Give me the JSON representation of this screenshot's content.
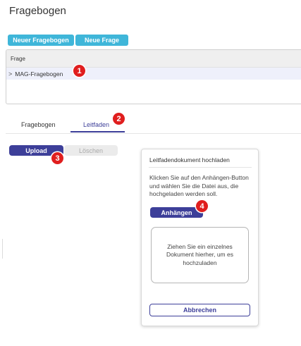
{
  "page": {
    "title": "Fragebogen"
  },
  "toolbar": {
    "new_questionnaire_label": "Neuer Fragebogen",
    "new_question_label": "Neue Frage"
  },
  "question_panel": {
    "header": "Frage",
    "items": [
      {
        "chevron": ">",
        "label": "MAG-Fragebogen"
      }
    ]
  },
  "tabs": [
    {
      "label": "Fragebogen",
      "active": false
    },
    {
      "label": "Leitfaden",
      "active": true
    }
  ],
  "actions": {
    "upload_label": "Upload",
    "delete_label": "Löschen"
  },
  "dialog": {
    "title": "Leitfadendokument hochladen",
    "instructions": "Klicken Sie auf den Anhängen-Button und wählen Sie die Datei aus, die hochgeladen werden soll.",
    "attach_label": "Anhängen",
    "dropzone_text": "Ziehen Sie ein einzelnes Dokument hierher, um es hochzuladen",
    "cancel_label": "Abbrechen"
  },
  "callouts": [
    "1",
    "2",
    "3",
    "4"
  ],
  "colors": {
    "accent": "#3d3f99",
    "toolbar_button": "#3fb6d9",
    "callout": "#e01e1e",
    "selected_row": "#eef0fb"
  }
}
